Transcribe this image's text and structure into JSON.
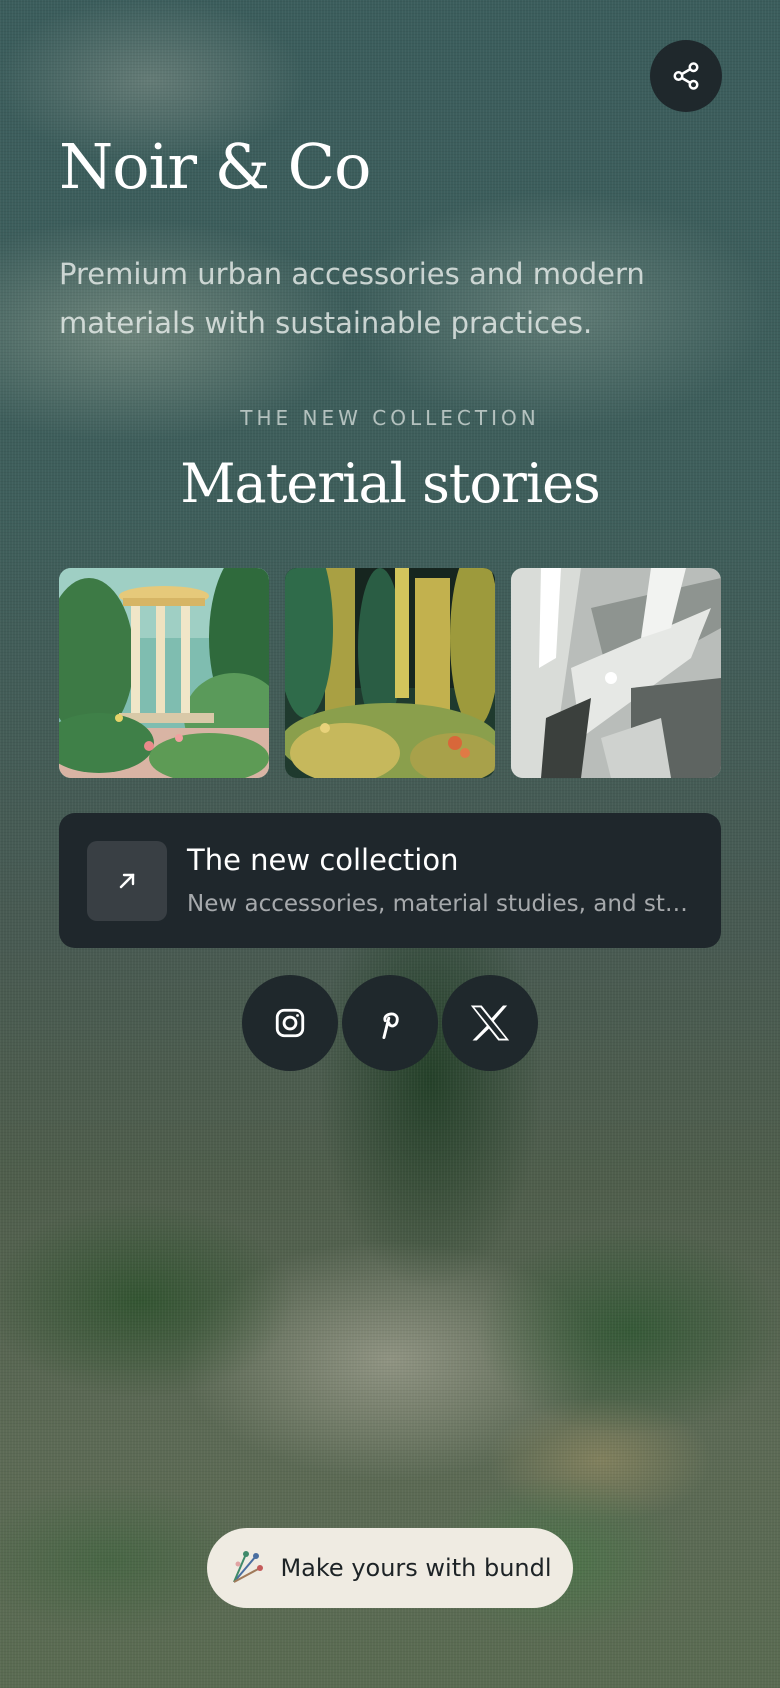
{
  "header": {
    "share_icon": "share-icon",
    "title": "Noir & Co",
    "description": "Premium urban accessories and modern materials with sustainable practices."
  },
  "section": {
    "eyebrow": "THE NEW COLLECTION",
    "title": "Material stories"
  },
  "gallery": [
    {
      "subject": "garden temple painting"
    },
    {
      "subject": "forest painting"
    },
    {
      "subject": "grey abstract painting"
    }
  ],
  "link_card": {
    "icon": "arrow-up-right-icon",
    "title": "The new collection",
    "subtitle": "New accessories, material studies, and stories from the studio"
  },
  "social": [
    {
      "icon": "instagram-icon"
    },
    {
      "icon": "pinterest-icon"
    },
    {
      "icon": "x-icon"
    }
  ],
  "footer": {
    "icon": "bundl-logo-icon",
    "label": "Make yours with bundl"
  },
  "colors": {
    "button_dark": "#1f282c",
    "card_dark": "#1f272c",
    "pill_bg": "#efebe2",
    "title_text": "#ffffff"
  }
}
